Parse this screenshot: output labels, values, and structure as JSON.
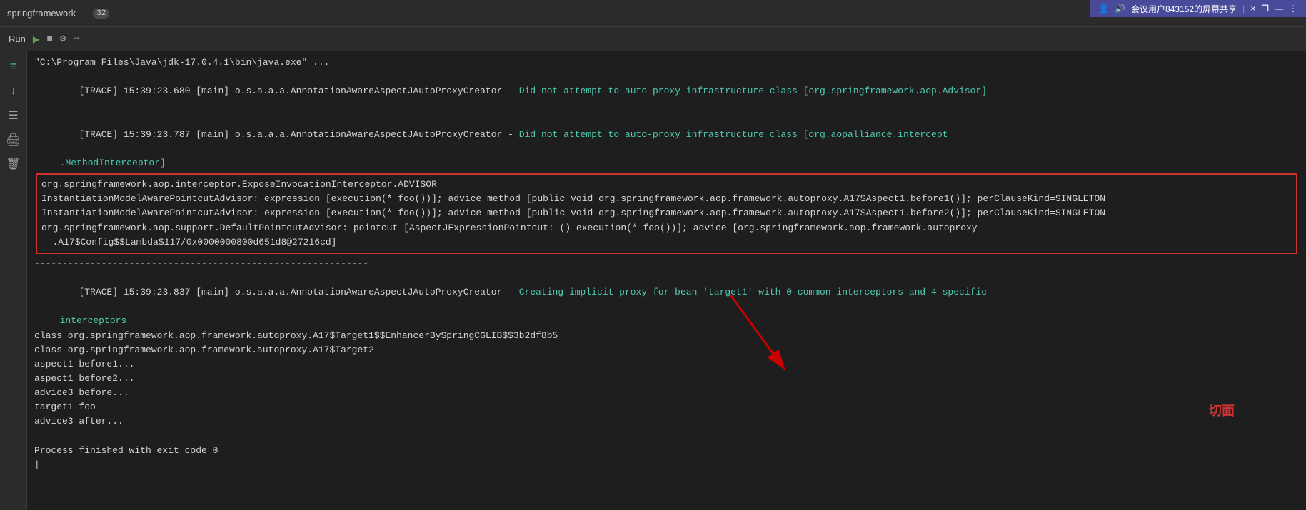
{
  "topbar": {
    "title": "springframework",
    "run_label": "Run",
    "tab_count": "32",
    "icons": [
      "▶",
      "■",
      "⚙",
      "⋯"
    ],
    "window_controls": [
      "×",
      "❐",
      "—",
      "⋮"
    ]
  },
  "userbar": {
    "text": "会议用户843152的屏幕共享",
    "icons": [
      "👤",
      "🔊"
    ]
  },
  "sidebar": {
    "icons": [
      {
        "name": "filter-icon",
        "symbol": "≡"
      },
      {
        "name": "sort-down-icon",
        "symbol": "↓"
      },
      {
        "name": "format-icon",
        "symbol": "☰"
      },
      {
        "name": "print-icon",
        "symbol": "🖨"
      },
      {
        "name": "delete-icon",
        "symbol": "🗑"
      }
    ]
  },
  "console": {
    "lines": [
      {
        "id": "l1",
        "text": "\"C:\\Program Files\\Java\\jdk-17.0.4.1\\bin\\java.exe\" ...",
        "style": "white"
      },
      {
        "id": "l2",
        "text": "[TRACE] 15:39:23.680 [main] o.s.a.a.a.AnnotationAwareAspectJAutoProxyCreator - ",
        "style": "white",
        "highlight": "Did not attempt to auto-proxy infrastructure class [org.springframework.aop.Advisor]"
      },
      {
        "id": "l3",
        "text": "[TRACE] 15:39:23.787 [main] o.s.a.a.a.AnnotationAwareAspectJAutoProxyCreator - ",
        "style": "white",
        "highlight": "Did not attempt to auto-proxy infrastructure class [org.aopalliance.intercept"
      },
      {
        "id": "l3b",
        "text": "  .MethodInterceptor]",
        "style": "cyan",
        "indent": true
      },
      {
        "id": "l4",
        "text": "org.springframework.aop.interceptor.ExposeInvocationInterceptor.ADVISOR",
        "style": "white",
        "boxed": true
      },
      {
        "id": "l5",
        "text": "InstantiationModelAwarePointcutAdvisor: expression [execution(* foo())]; advice method [public void org.springframework.aop.framework.autoproxy.A17$Aspect1.before1()]; perClauseKind=SINGLETON",
        "style": "white",
        "boxed": true
      },
      {
        "id": "l6",
        "text": "InstantiationModelAwarePointcutAdvisor: expression [execution(* foo())]; advice method [public void org.springframework.aop.framework.autoproxy.A17$Aspect1.before2()]; perClauseKind=SINGLETON",
        "style": "white",
        "boxed": true
      },
      {
        "id": "l7",
        "text": "org.springframework.aop.support.DefaultPointcutAdvisor: pointcut [AspectJExpressionPointcut: () execution(* foo())]; advice [org.springframework.aop.framework.autoproxy.A17$Config$$Lambda$117/0x0000000800d651d8@27216cd]",
        "style": "white",
        "boxed": true
      },
      {
        "id": "sep",
        "text": "------------------------------------------------------------",
        "style": "gray"
      },
      {
        "id": "l8",
        "text": "[TRACE] 15:39:23.837 [main] o.s.a.a.a.AnnotationAwareAspectJAutoProxyCreator - ",
        "style": "white",
        "highlight": "Creating implicit proxy for bean 'target1' with 0 common interceptors and 4 specific"
      },
      {
        "id": "l8b",
        "text": "  interceptors",
        "style": "cyan",
        "indent": true
      },
      {
        "id": "l9",
        "text": "class org.springframework.aop.framework.autoproxy.A17$Target1$$EnhancerBySpringCGLIB$$3b2df8b5",
        "style": "white"
      },
      {
        "id": "l10",
        "text": "class org.springframework.aop.framework.autoproxy.A17$Target2",
        "style": "white"
      },
      {
        "id": "l11",
        "text": "aspect1 before1...",
        "style": "white"
      },
      {
        "id": "l12",
        "text": "aspect1 before2...",
        "style": "white"
      },
      {
        "id": "l13",
        "text": "advice3 before...",
        "style": "white"
      },
      {
        "id": "l14",
        "text": "target1 foo",
        "style": "white"
      },
      {
        "id": "l15",
        "text": "advice3 after...",
        "style": "white"
      },
      {
        "id": "l16",
        "text": "",
        "style": "white"
      },
      {
        "id": "l17",
        "text": "Process finished with exit code 0",
        "style": "white"
      },
      {
        "id": "l18",
        "text": "|",
        "style": "white"
      }
    ]
  },
  "annotation": {
    "label": "切面"
  }
}
